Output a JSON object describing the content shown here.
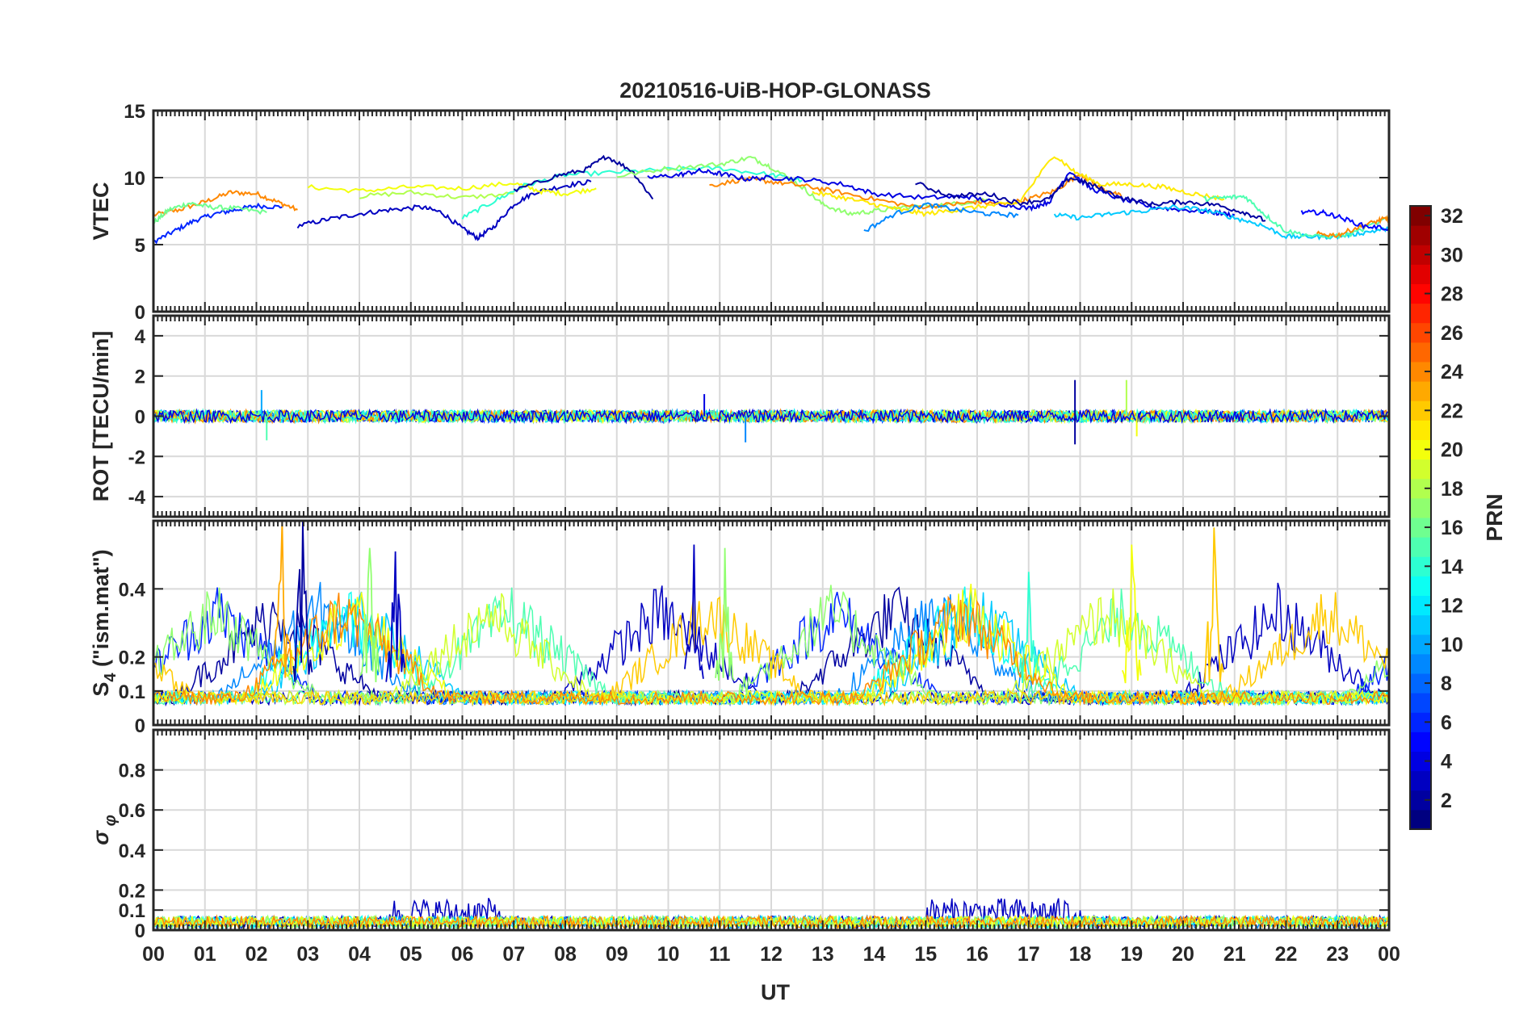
{
  "title": "20210516-UiB-HOP-GLONASS",
  "x_axis": {
    "label": "UT",
    "ticks": [
      "00",
      "01",
      "02",
      "03",
      "04",
      "05",
      "06",
      "07",
      "08",
      "09",
      "10",
      "11",
      "12",
      "13",
      "14",
      "15",
      "16",
      "17",
      "18",
      "19",
      "20",
      "21",
      "22",
      "23",
      "00"
    ],
    "range_hours": [
      0,
      24
    ]
  },
  "colorbar": {
    "label": "PRN",
    "ticks": [
      "2",
      "4",
      "6",
      "8",
      "10",
      "12",
      "14",
      "16",
      "18",
      "20",
      "22",
      "24",
      "26",
      "28",
      "30",
      "32"
    ],
    "range": [
      1,
      32
    ],
    "colormap": "jet"
  },
  "chart_data": [
    {
      "type": "line",
      "panel": "vtec",
      "ylabel": "VTEC",
      "ylim": [
        0,
        15
      ],
      "yticks": [
        "0",
        "5",
        "10",
        "15"
      ],
      "grid": true,
      "series": [
        {
          "prn": 24,
          "x": [
            0.0,
            0.5,
            1.0,
            1.5,
            2.0,
            2.4,
            2.8
          ],
          "y": [
            7.2,
            7.6,
            8.2,
            8.9,
            8.8,
            8.2,
            7.6
          ]
        },
        {
          "prn": 6,
          "x": [
            0.0,
            0.4,
            0.8,
            1.2,
            1.6,
            2.0,
            2.5
          ],
          "y": [
            5.2,
            6.0,
            6.8,
            7.3,
            7.6,
            7.9,
            7.8
          ]
        },
        {
          "prn": 16,
          "x": [
            0.0,
            0.3,
            0.7,
            1.1,
            1.6,
            2.2
          ],
          "y": [
            6.6,
            7.6,
            8.1,
            7.8,
            7.7,
            7.4
          ]
        },
        {
          "prn": 3,
          "x": [
            2.8,
            3.4,
            4.0,
            4.6,
            5.2,
            5.6,
            6.0,
            6.3,
            6.6,
            7.0,
            7.4,
            8.0,
            8.5
          ],
          "y": [
            6.4,
            6.9,
            7.3,
            7.6,
            7.8,
            7.4,
            6.2,
            5.5,
            6.3,
            8.0,
            8.9,
            9.4,
            9.7
          ]
        },
        {
          "prn": 20,
          "x": [
            3.0,
            4.0,
            5.0,
            6.0,
            7.0,
            7.5,
            8.0,
            8.6
          ],
          "y": [
            9.3,
            9.0,
            9.3,
            9.2,
            9.6,
            9.0,
            8.8,
            9.2
          ]
        },
        {
          "prn": 18,
          "x": [
            4.0,
            5.0,
            6.0,
            7.0
          ],
          "y": [
            8.6,
            8.9,
            8.5,
            8.8
          ]
        },
        {
          "prn": 14,
          "x": [
            6.0,
            6.6,
            7.2,
            8.0,
            9.0,
            10.0,
            11.0,
            12.0,
            12.6
          ],
          "y": [
            7.0,
            8.2,
            9.4,
            10.2,
            10.4,
            10.6,
            10.7,
            10.2,
            9.8
          ]
        },
        {
          "prn": 2,
          "x": [
            7.0,
            7.8,
            8.4,
            8.8,
            9.3,
            9.7
          ],
          "y": [
            9.0,
            10.1,
            10.6,
            11.6,
            10.5,
            8.4
          ]
        },
        {
          "prn": 17,
          "x": [
            9.0,
            10.0,
            11.0,
            11.6,
            12.0,
            12.6,
            13.0,
            13.5,
            14.0,
            14.6,
            15.5,
            16.2
          ],
          "y": [
            10.1,
            10.7,
            11.0,
            11.5,
            10.8,
            9.3,
            8.0,
            7.3,
            7.5,
            7.8,
            8.0,
            8.4
          ]
        },
        {
          "prn": 24,
          "x": [
            10.8,
            11.5,
            12.0,
            12.6,
            13.2,
            14.0,
            14.8,
            15.5,
            16.0,
            16.5,
            17.0,
            17.5,
            18.0,
            18.4,
            18.8
          ],
          "y": [
            9.4,
            9.9,
            9.7,
            9.4,
            9.0,
            8.4,
            7.8,
            8.0,
            8.2,
            8.0,
            8.4,
            9.0,
            10.3,
            9.2,
            8.6
          ]
        },
        {
          "prn": 4,
          "x": [
            9.6,
            10.2,
            10.6,
            11.0,
            11.5,
            12.0,
            12.6,
            13.4,
            14.0,
            15.0,
            15.8,
            16.4,
            17.0,
            17.4,
            17.8,
            18.2,
            18.8,
            19.4,
            20.0,
            20.6,
            21.0
          ],
          "y": [
            10.0,
            10.2,
            10.5,
            10.3,
            9.9,
            10.0,
            9.9,
            9.5,
            8.8,
            8.5,
            8.6,
            8.1,
            7.7,
            8.2,
            10.5,
            9.2,
            8.4,
            7.8,
            7.6,
            7.4,
            7.2
          ]
        },
        {
          "prn": 21,
          "x": [
            12.8,
            13.4,
            14.0,
            14.5,
            15.0,
            15.6,
            16.2,
            16.8,
            17.5,
            17.9,
            18.4,
            19.0,
            19.6,
            20.2,
            20.8
          ],
          "y": [
            8.9,
            8.5,
            8.0,
            7.6,
            7.3,
            7.6,
            7.9,
            8.1,
            11.7,
            10.4,
            9.5,
            9.5,
            9.3,
            8.8,
            8.4
          ]
        },
        {
          "prn": 9,
          "x": [
            13.8,
            14.4,
            15.0,
            15.6,
            16.2,
            16.8
          ],
          "y": [
            6.0,
            7.3,
            8.0,
            7.6,
            7.3,
            7.2
          ]
        },
        {
          "prn": 2,
          "x": [
            14.8,
            15.5,
            16.2,
            16.8,
            17.4,
            17.8,
            18.2,
            18.8,
            19.4,
            20.0,
            20.6,
            21.2,
            21.6
          ],
          "y": [
            9.6,
            8.6,
            8.8,
            8.1,
            8.4,
            10.0,
            9.5,
            8.5,
            8.0,
            8.2,
            8.0,
            7.4,
            6.8
          ]
        },
        {
          "prn": 11,
          "x": [
            17.5,
            18.0,
            18.6,
            19.2,
            19.8,
            20.4,
            21.0,
            21.5,
            22.0,
            22.5,
            23.0,
            23.5,
            24.0
          ],
          "y": [
            7.2,
            7.0,
            7.3,
            7.5,
            7.8,
            7.6,
            7.0,
            6.5,
            5.6,
            5.6,
            5.6,
            5.9,
            6.2
          ]
        },
        {
          "prn": 15,
          "x": [
            20.4,
            20.8,
            21.2,
            21.6,
            22.0,
            22.6,
            23.2,
            24.0
          ],
          "y": [
            8.4,
            8.5,
            8.6,
            7.2,
            6.0,
            5.6,
            5.7,
            7.0
          ]
        },
        {
          "prn": 24,
          "x": [
            22.6,
            23.0,
            23.4,
            23.8,
            24.0
          ],
          "y": [
            5.8,
            5.7,
            6.3,
            6.8,
            7.0
          ]
        },
        {
          "prn": 5,
          "x": [
            22.3,
            22.7,
            23.0,
            23.5,
            24.0
          ],
          "y": [
            7.4,
            7.4,
            7.1,
            6.4,
            6.2
          ]
        }
      ]
    },
    {
      "type": "line",
      "panel": "rot",
      "ylabel": "ROT [TECU/min]",
      "ylim": [
        -5,
        5
      ],
      "yticks": [
        "-4",
        "-2",
        "0",
        "2",
        "4"
      ],
      "grid": true,
      "notes_style": "noisy traces centred on 0, amplitude mostly within ±0.5, spikes near 02, 11-12, 18, 19",
      "spikes": [
        {
          "prn": 10,
          "x": 2.1,
          "y": 1.3
        },
        {
          "prn": 15,
          "x": 2.2,
          "y": -1.2
        },
        {
          "prn": 4,
          "x": 10.7,
          "y": 1.1
        },
        {
          "prn": 9,
          "x": 11.5,
          "y": -1.3
        },
        {
          "prn": 2,
          "x": 17.9,
          "y": 1.8
        },
        {
          "prn": 2,
          "x": 17.9,
          "y": -1.4
        },
        {
          "prn": 18,
          "x": 18.9,
          "y": 1.8
        },
        {
          "prn": 20,
          "x": 19.1,
          "y": -1.0
        }
      ]
    },
    {
      "type": "line",
      "panel": "s4",
      "ylabel": "S4 (\"ism.mat\")",
      "ylim": [
        0,
        0.6
      ],
      "yticks": [
        "0",
        "0.1",
        "0.2",
        "0.4"
      ],
      "grid": true,
      "notes_style": "noisy traces, baseline 0.05-0.1, bursts up to ~0.6 near 02-03, 07-12, 19, 20.5",
      "peaks": [
        {
          "prn": 23,
          "x": 2.5,
          "y": 0.6
        },
        {
          "prn": 2,
          "x": 2.9,
          "y": 0.6
        },
        {
          "prn": 17,
          "x": 4.2,
          "y": 0.52
        },
        {
          "prn": 3,
          "x": 4.7,
          "y": 0.51
        },
        {
          "prn": 3,
          "x": 10.5,
          "y": 0.53
        },
        {
          "prn": 17,
          "x": 11.1,
          "y": 0.52
        },
        {
          "prn": 20,
          "x": 19.0,
          "y": 0.53
        },
        {
          "prn": 22,
          "x": 20.6,
          "y": 0.58
        },
        {
          "prn": 14,
          "x": 17.0,
          "y": 0.45
        }
      ]
    },
    {
      "type": "line",
      "panel": "sigma",
      "ylabel": "σ φ",
      "ylim": [
        0,
        1
      ],
      "yticks": [
        "0",
        "0.1",
        "0.2",
        "0.4",
        "0.6",
        "0.8"
      ],
      "grid": true,
      "notes_style": "noisy traces near 0.02-0.1, bursts to ~0.2 near 04.5-06.5 and 15-17"
    }
  ]
}
